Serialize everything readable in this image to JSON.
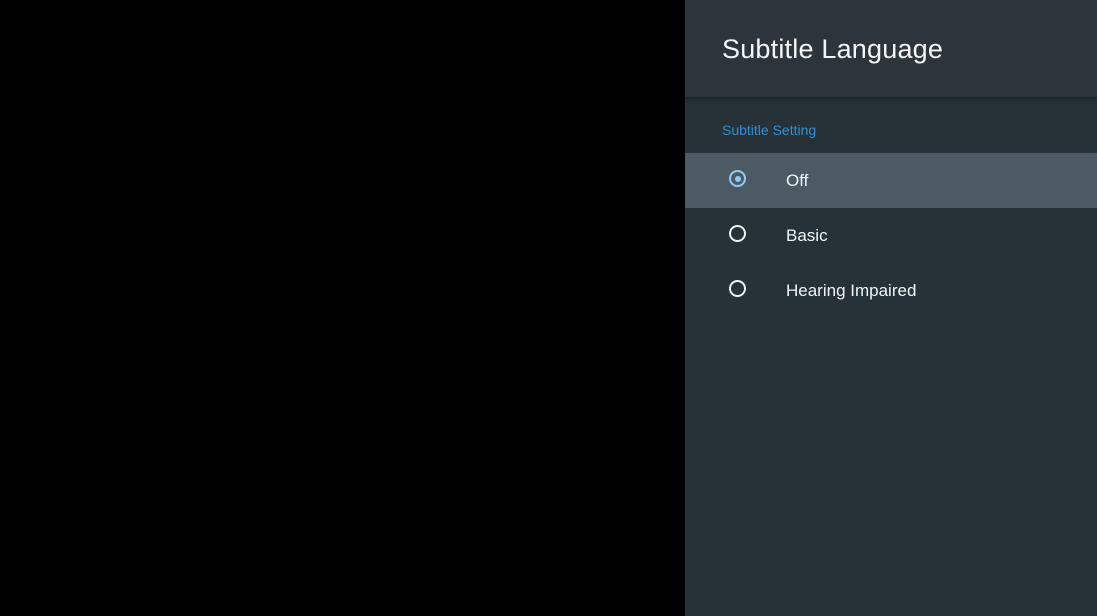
{
  "panel": {
    "title": "Subtitle Language",
    "section_label": "Subtitle Setting",
    "options": [
      {
        "label": "Off",
        "selected": true,
        "focused": true
      },
      {
        "label": "Basic",
        "selected": false,
        "focused": false
      },
      {
        "label": "Hearing Impaired",
        "selected": false,
        "focused": false
      }
    ]
  },
  "colors": {
    "panel_background": "#263238",
    "header_background": "#2c353b",
    "focused_row": "#4b5a63",
    "accent": "#2f8fd6",
    "radio_checked": "#8fcbf5"
  },
  "icons": {
    "selected": "radio-checked-icon",
    "unselected": "radio-unchecked-icon"
  }
}
